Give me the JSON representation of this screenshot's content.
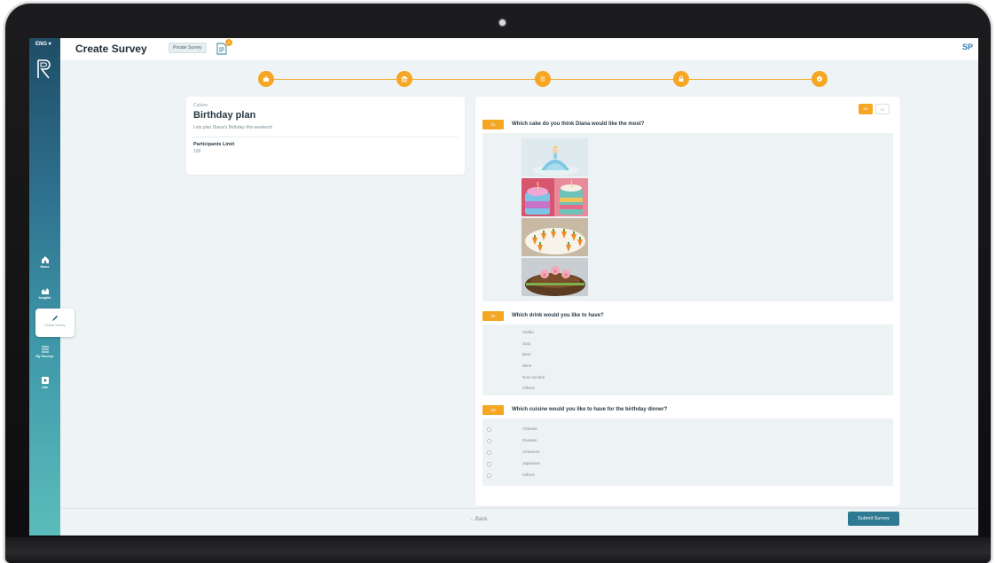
{
  "app": {
    "language": "ENG",
    "page_title": "Create Survey",
    "privacy_badge": "Private Survey",
    "doc_count": "2",
    "user_initials": "SP"
  },
  "sidebar": {
    "items": [
      {
        "label": "Home",
        "icon": "home-icon"
      },
      {
        "label": "Insights",
        "icon": "chart-icon"
      },
      {
        "label": "Create Survey",
        "icon": "pencil-icon",
        "active": true
      },
      {
        "label": "My Surveys",
        "icon": "list-icon"
      },
      {
        "label": "Ads",
        "icon": "play-icon"
      }
    ]
  },
  "stepper": {
    "steps": [
      {
        "icon": "briefcase-icon",
        "done": true
      },
      {
        "icon": "bank-icon",
        "done": true
      },
      {
        "icon": "list-icon",
        "done": true
      },
      {
        "icon": "lock-icon",
        "done": true
      },
      {
        "icon": "check-icon",
        "done": true
      }
    ]
  },
  "survey_info": {
    "category": "Culture",
    "title": "Birthday plan",
    "description": "Lets plan Diana's Birthday this weekend.",
    "participants_label": "Participants Limit",
    "participants_value": "100"
  },
  "languages": {
    "active": "EN",
    "inactive": "KR"
  },
  "questions": [
    {
      "number": "01",
      "text": "Which cake do you think Diana would like the most?",
      "type": "image",
      "options": [
        "princess-doll-cake",
        "unicorn-cupcakes-cake",
        "carrot-topped-cake",
        "pig-mud-cake"
      ]
    },
    {
      "number": "02",
      "text": "Which drink would you like to have?",
      "type": "list",
      "options": [
        "Vodka",
        "Soju",
        "Beer",
        "Wine",
        "Non-Alcohol",
        "Others"
      ]
    },
    {
      "number": "03",
      "text": "Which cuisine would you like to have for the birthday dinner?",
      "type": "radio",
      "options": [
        "Chinese",
        "Russian",
        "American",
        "Japanese",
        "Others"
      ]
    }
  ],
  "footer": {
    "back_label": "Back",
    "submit_label": "Submit Survey"
  },
  "colors": {
    "accent": "#f5a623",
    "primary": "#2e7a93",
    "sidebar_top": "#1f4d66",
    "sidebar_bottom": "#5bbdbb"
  }
}
